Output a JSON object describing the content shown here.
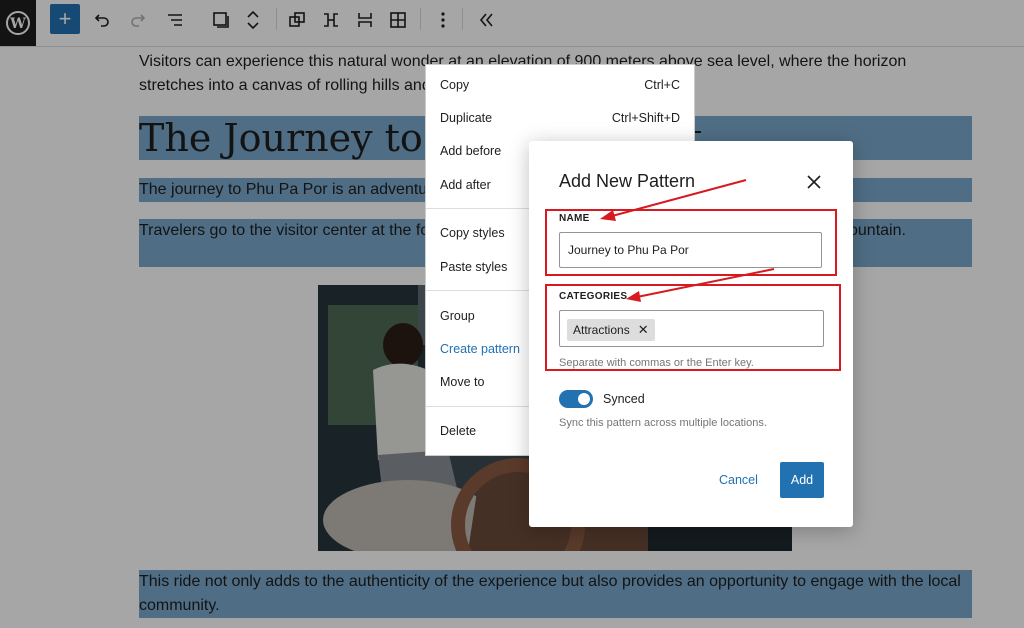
{
  "toolbar": {
    "add_label": "+",
    "undo_icon": "undo-icon",
    "redo_icon": "redo-icon",
    "items": [
      "list-view-icon",
      "block-icon",
      "move-icon",
      "duplicate-icon",
      "ungroup-icon",
      "stretch-icon",
      "grid-icon",
      "options-icon",
      "collapse-icon"
    ]
  },
  "content": {
    "para1": "Visitors can experience this natural wonder at an elevation of 900 meters above sea level, where the horizon stretches into a canvas of rolling hills and valleys.",
    "heading": "The Journey to the Viewpoint",
    "para2": "The journey to Phu Pa Por is an adventure in itself.",
    "para3": "Travelers go to the visitor center at the foot of the hill and take a local tractor ride up to ascend the mountain.",
    "para4": "This ride not only adds to the authenticity of the experience but also provides an opportunity to engage with the local community."
  },
  "menu": {
    "copy": "Copy",
    "copy_shortcut": "Ctrl+C",
    "duplicate": "Duplicate",
    "duplicate_shortcut": "Ctrl+Shift+D",
    "add_before": "Add before",
    "add_after": "Add after",
    "copy_styles": "Copy styles",
    "paste_styles": "Paste styles",
    "group": "Group",
    "create_pattern": "Create pattern",
    "move_to": "Move to",
    "delete": "Delete"
  },
  "modal": {
    "title": "Add New Pattern",
    "name_label": "NAME",
    "name_value": "Journey to Phu Pa Por",
    "categories_label": "CATEGORIES",
    "token": "Attractions",
    "categories_help": "Separate with commas or the Enter key.",
    "synced_label": "Synced",
    "synced_on": true,
    "synced_help": "Sync this pattern across multiple locations.",
    "cancel": "Cancel",
    "add": "Add"
  },
  "colors": {
    "accent": "#2271b1",
    "selection": "#7aa9cd",
    "annotation": "#d8191f"
  }
}
